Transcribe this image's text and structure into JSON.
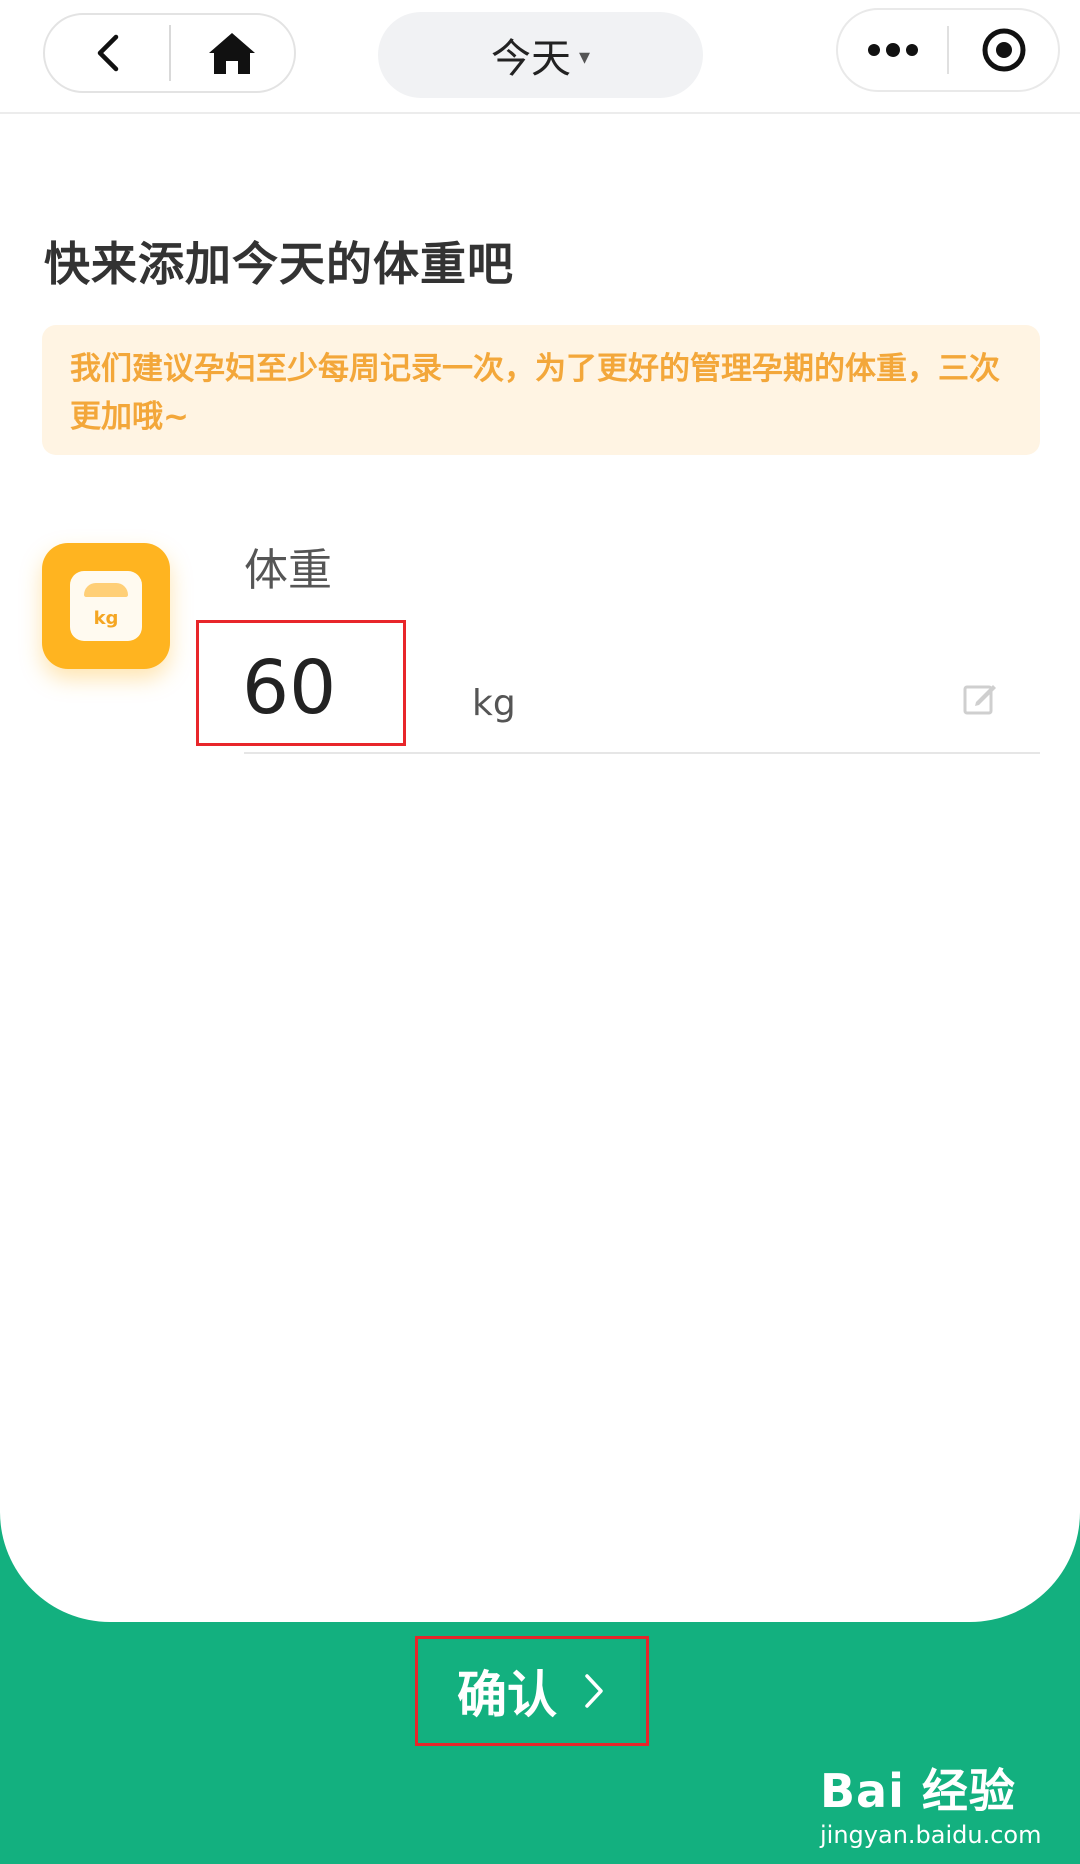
{
  "header": {
    "title": "今天",
    "title_caret": "▾"
  },
  "main": {
    "heading": "快来添加今天的体重吧",
    "tip": "我们建议孕妇至少每周记录一次，为了更好的管理孕期的体重，三次更加哦~",
    "field_label": "体重",
    "weight_value": "60",
    "unit": "kg",
    "icon_text": "kg"
  },
  "footer": {
    "confirm_label": "确认"
  },
  "watermark": {
    "brand": "Bai 经验",
    "url": "jingyan.baidu.com"
  },
  "colors": {
    "accent_green": "#13b07f",
    "tip_bg": "#fff4e3",
    "tip_text": "#f3a73a",
    "icon_orange": "#ffb420",
    "highlight_red": "#e8262a"
  }
}
